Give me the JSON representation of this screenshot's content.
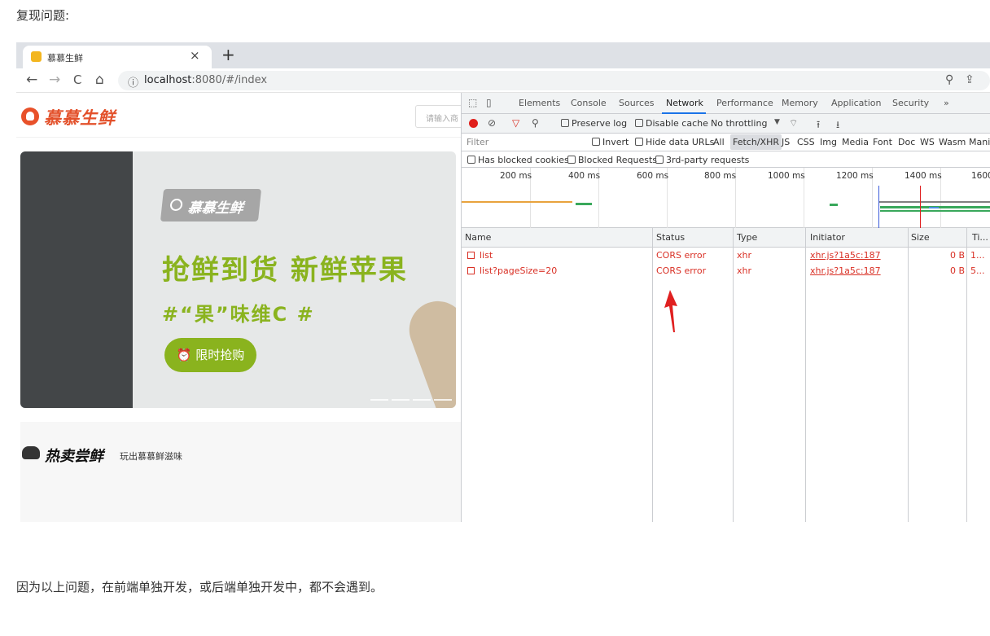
{
  "doc": {
    "heading": "复现问题:",
    "footer": "因为以上问题，在前端单独开发，或后端单独开发中，都不会遇到。"
  },
  "browser": {
    "tab_title": "慕慕生鲜",
    "close_glyph": "×",
    "new_tab_glyph": "+",
    "back_glyph": "←",
    "forward_glyph": "→",
    "reload_glyph": "C",
    "home_glyph": "⌂",
    "info_glyph": "ⓘ",
    "url_host": "localhost",
    "url_rest": ":8080/#/index",
    "zoom_glyph": "⚲",
    "share_glyph": "⇪"
  },
  "page": {
    "logo_text": "慕慕生鲜",
    "search_placeholder": "请输入商",
    "banner_logo_text": "慕慕生鲜",
    "banner_headline": "抢鲜到货  新鲜苹果",
    "banner_sub": "#“果”味维C #",
    "banner_button": "⏰ 限时抢购",
    "hot_title": "热卖尝鲜",
    "hot_subtitle": "玩出慕慕鲜滋味"
  },
  "devtools": {
    "tabs": [
      "Elements",
      "Console",
      "Sources",
      "Network",
      "Performance",
      "Memory",
      "Application",
      "Security",
      "»"
    ],
    "preserve_log": "Preserve log",
    "disable_cache": "Disable cache",
    "throttling": "No throttling",
    "filter_placeholder": "Filter",
    "invert": "Invert",
    "hide_data_urls": "Hide data URLs",
    "type_filters": [
      "All",
      "Fetch/XHR",
      "JS",
      "CSS",
      "Img",
      "Media",
      "Font",
      "Doc",
      "WS",
      "Wasm",
      "Mani"
    ],
    "blocked_options": [
      "Has blocked cookies",
      "Blocked Requests",
      "3rd-party requests"
    ],
    "timeline_ticks": [
      "200 ms",
      "400 ms",
      "600 ms",
      "800 ms",
      "1000 ms",
      "1200 ms",
      "1400 ms",
      "1600"
    ],
    "columns": [
      "Name",
      "Status",
      "Type",
      "Initiator",
      "Size",
      "Ti..."
    ],
    "rows": [
      {
        "name": "list",
        "status": "CORS error",
        "type": "xhr",
        "initiator": "xhr.js?1a5c:187",
        "size": "0 B",
        "time": "1..."
      },
      {
        "name": "list?pageSize=20",
        "status": "CORS error",
        "type": "xhr",
        "initiator": "xhr.js?1a5c:187",
        "size": "0 B",
        "time": "5..."
      }
    ]
  },
  "colors": {
    "accent_green": "#8ab31e",
    "logo_red": "#e3512b",
    "error_red": "#d93025",
    "annotation_red": "#e02020"
  }
}
